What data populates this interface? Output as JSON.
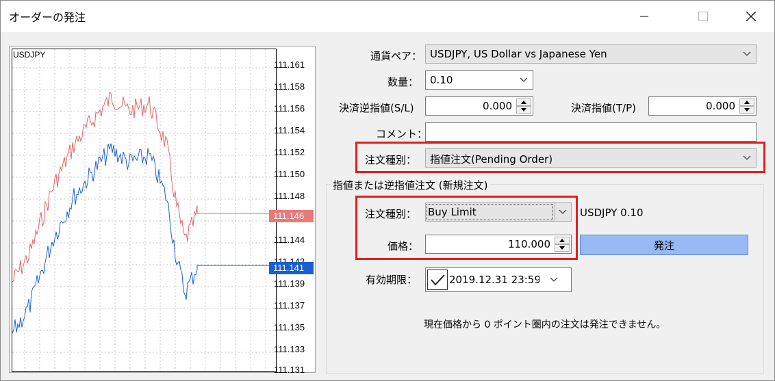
{
  "window": {
    "title": "オーダーの発注"
  },
  "chart": {
    "symbol": "USDJPY",
    "price_labels": [
      "111.161",
      "111.158",
      "111.156",
      "111.154",
      "111.152",
      "111.150",
      "111.148",
      "111.144",
      "111.142",
      "111.139",
      "111.137",
      "111.135",
      "111.133",
      "111.131"
    ],
    "ask_tag": "111.146",
    "bid_tag": "111.141",
    "colors": {
      "ask": "#e06666",
      "bid": "#1a5fd0",
      "ask_tag_bg": "#e87a7a",
      "bid_tag_bg": "#1a5fd0"
    }
  },
  "form": {
    "currency_pair": {
      "label": "通貨ペア：",
      "value": "USDJPY, US Dollar vs Japanese Yen"
    },
    "volume": {
      "label": "数量：",
      "value": "0.10"
    },
    "stop_loss": {
      "label": "決済逆指値(S/L)",
      "value": "0.000"
    },
    "take_profit": {
      "label": "決済指値(T/P)",
      "value": "0.000"
    },
    "comment": {
      "label": "コメント：",
      "value": ""
    },
    "order_type": {
      "label": "注文種別：",
      "value": "指値注文(Pending Order)"
    }
  },
  "pending": {
    "group_title": "指値または逆指値注文 (新規注文)",
    "type_label": "注文種別：",
    "type_value": "Buy Limit",
    "symbol_volume": "USDJPY 0.10",
    "price_label": "価格：",
    "price_value": "110.000",
    "place_button": "発注",
    "expiry_label": "有効期限：",
    "expiry_value": "2019.12.31 23:59",
    "notice": "現在価格から 0 ポイント圏内の注文は発注できません。"
  },
  "icons": [
    "minimize-icon",
    "maximize-icon",
    "close-icon",
    "chevron-down-icon",
    "spin-up-icon",
    "spin-down-icon",
    "checkmark-icon"
  ],
  "accent": {
    "highlight_red": "#e0201e",
    "button_blue": "#99b9f5"
  }
}
